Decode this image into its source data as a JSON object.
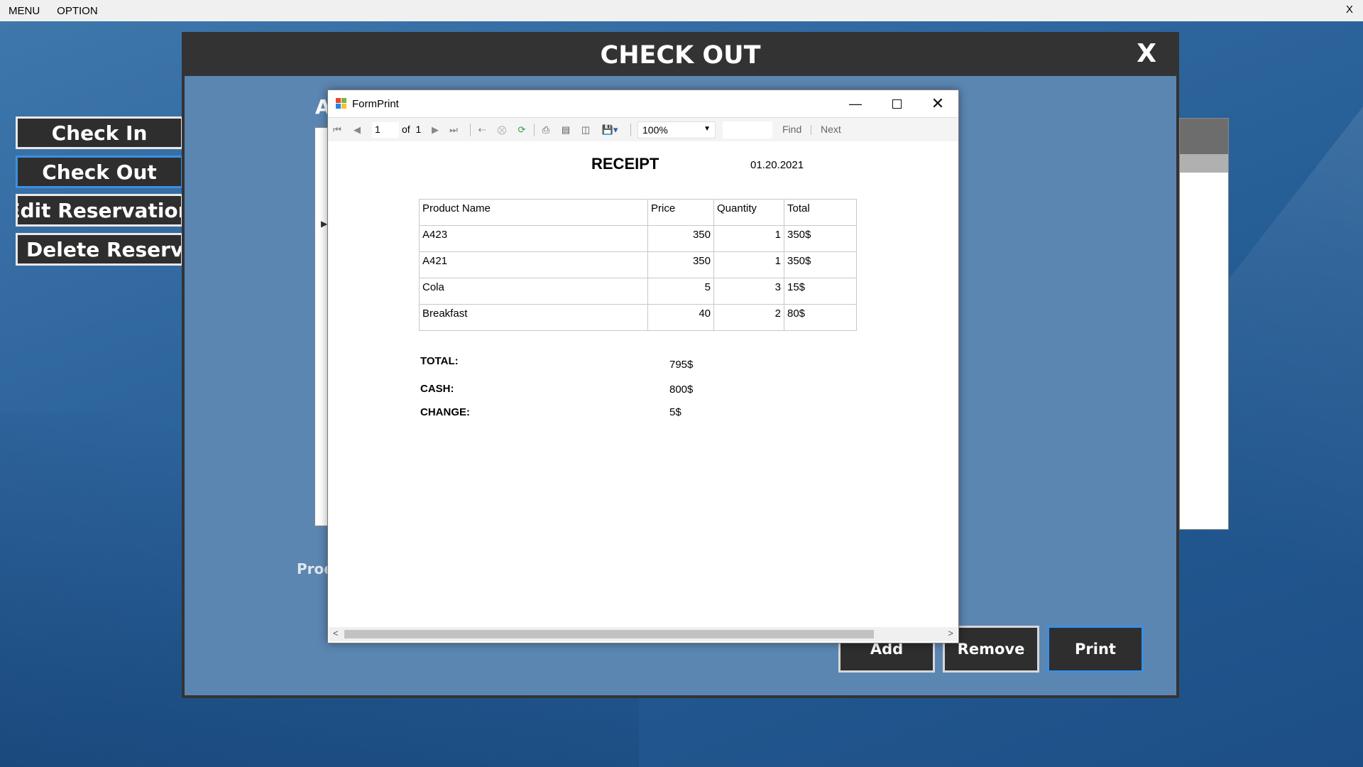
{
  "menubar": {
    "items": [
      "MENU",
      "OPTION"
    ],
    "close": "X"
  },
  "nav": {
    "check_in": "Check In",
    "check_out": "Check Out",
    "edit_reservation": "Edit Reservation",
    "delete_reservation": "Delete Reservatio"
  },
  "checkout": {
    "title": "CHECK OUT",
    "close": "X",
    "partial_label_a": "A",
    "product_label": "Produ",
    "buttons": {
      "add": "Add",
      "remove": "Remove",
      "print": "Print"
    }
  },
  "formprint": {
    "title": "FormPrint",
    "toolbar": {
      "page": "1",
      "of_label": "of",
      "total_pages": "1",
      "zoom": "100%",
      "find": "Find",
      "next": "Next"
    },
    "receipt": {
      "title": "RECEIPT",
      "date": "01.20.2021",
      "headers": [
        "Product Name",
        "Price",
        "Quantity",
        "Total"
      ],
      "rows": [
        [
          "A423",
          "350",
          "1",
          "350$"
        ],
        [
          "A421",
          "350",
          "1",
          "350$"
        ],
        [
          "Cola",
          "5",
          "3",
          "15$"
        ],
        [
          "Breakfast",
          "40",
          "2",
          "80$"
        ]
      ],
      "total_label": "TOTAL:",
      "total_value": "795$",
      "cash_label": "CASH:",
      "cash_value": "800$",
      "change_label": "CHANGE:",
      "change_value": "5$"
    }
  },
  "colors": {
    "desktop": "#2e659d",
    "window_header": "#333333",
    "window_body": "#5b86b2",
    "button": "#2e2e2e",
    "accent_border": "#3d8fe0"
  }
}
